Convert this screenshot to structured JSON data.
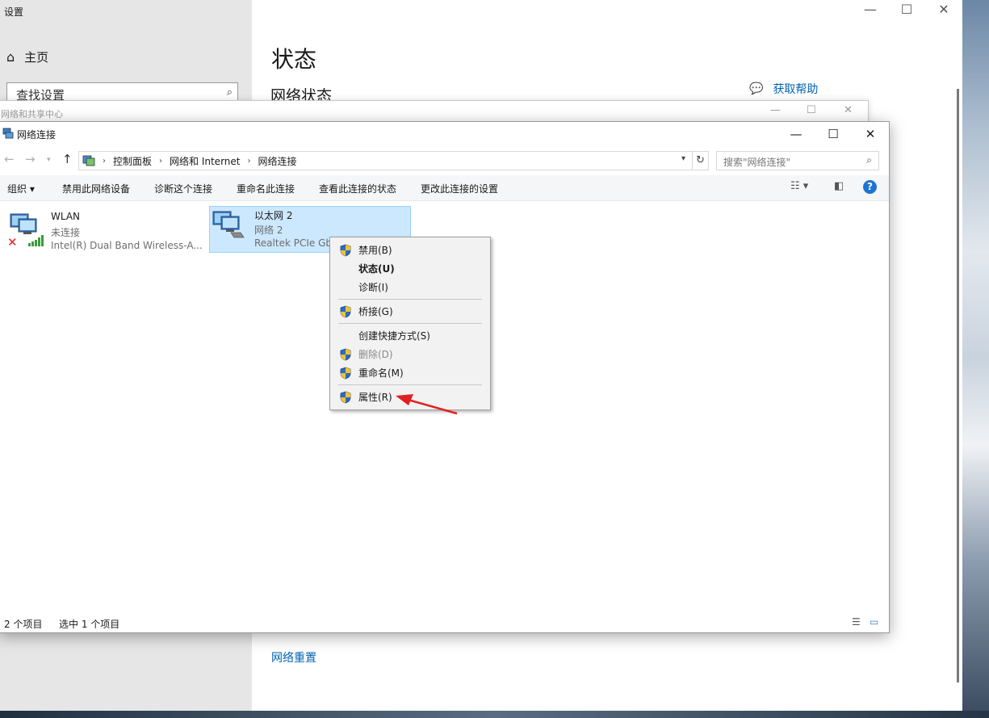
{
  "settings": {
    "title": "设置",
    "home": "主页",
    "search_placeholder": "查找设置",
    "page_title": "状态",
    "section_title": "网络状态",
    "get_help": "获取帮助",
    "network_reset": "网络重置"
  },
  "nsc_window": {
    "title": "网络和共享中心"
  },
  "window": {
    "title": "网络连接",
    "breadcrumb": [
      "控制面板",
      "网络和 Internet",
      "网络连接"
    ],
    "search_placeholder": "搜索\"网络连接\""
  },
  "toolbar": {
    "organize": "组织 ▾",
    "disable": "禁用此网络设备",
    "diagnose": "诊断这个连接",
    "rename": "重命名此连接",
    "view_status": "查看此连接的状态",
    "change_settings": "更改此连接的设置"
  },
  "connections": [
    {
      "name": "WLAN",
      "status": "未连接",
      "desc": "Intel(R) Dual Band Wireless-A..."
    },
    {
      "name": "以太网 2",
      "status": "网络 2",
      "desc": "Realtek PCIe Gb"
    }
  ],
  "statusbar": {
    "count": "2 个项目",
    "selected": "选中 1 个项目"
  },
  "context_menu": {
    "disable": "禁用(B)",
    "status": "状态(U)",
    "diagnose": "诊断(I)",
    "bridge": "桥接(G)",
    "shortcut": "创建快捷方式(S)",
    "delete": "删除(D)",
    "rename": "重命名(M)",
    "properties": "属性(R)"
  },
  "colors": {
    "accent": "#0063b1",
    "selection": "#cce8ff",
    "annotation_arrow": "#e02020"
  }
}
